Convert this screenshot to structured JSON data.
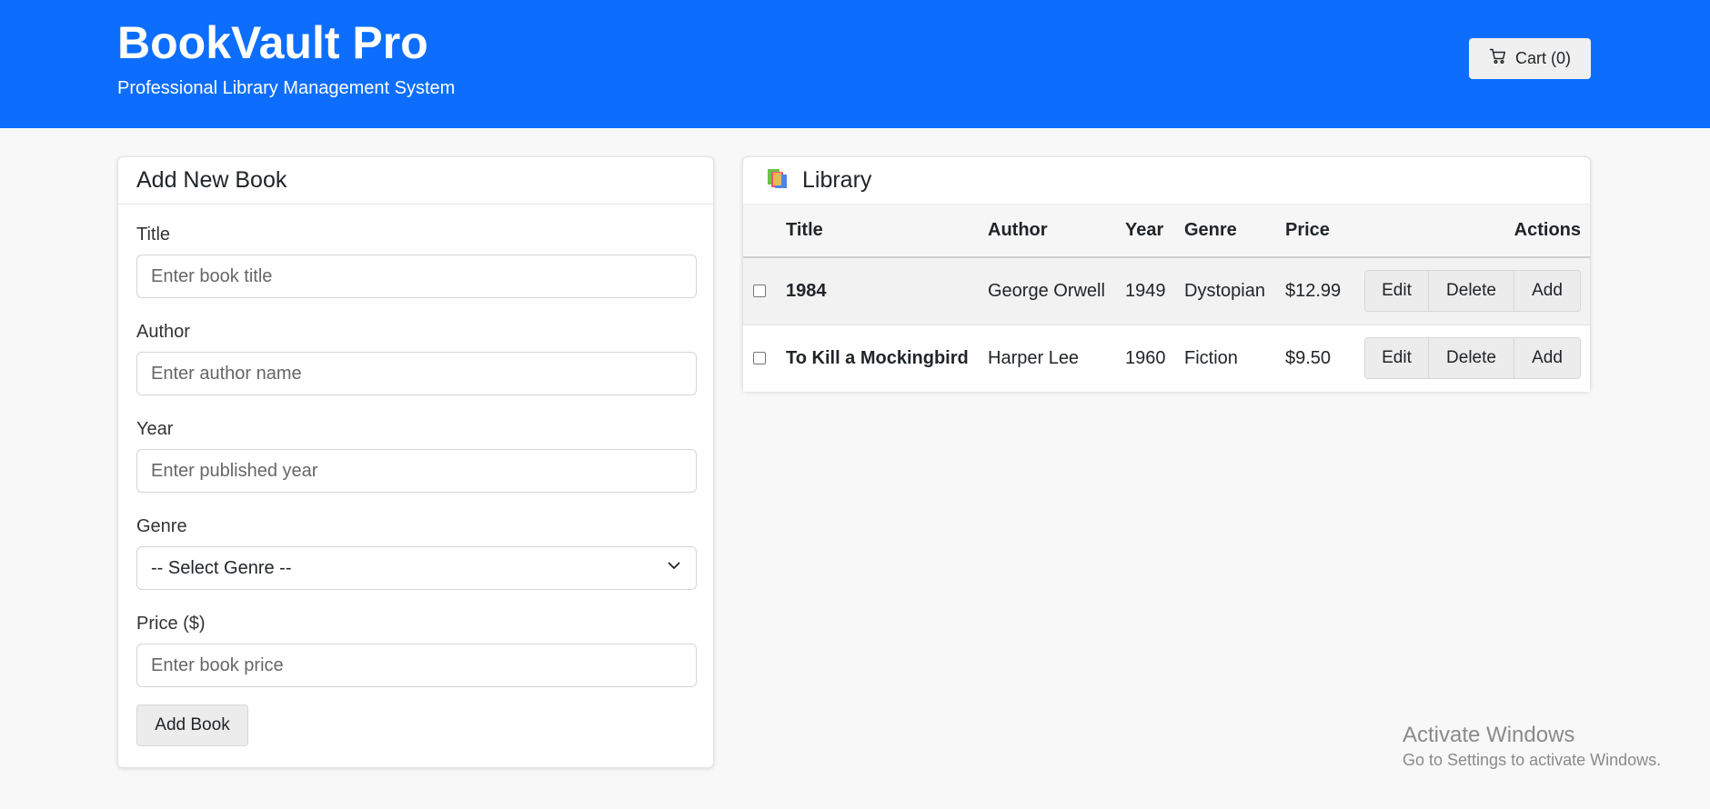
{
  "header": {
    "title": "BookVault Pro",
    "subtitle": "Professional Library Management System",
    "cart_label": "Cart (0)",
    "cart_icon": "cart-icon",
    "background_color": "#0d6efd"
  },
  "form": {
    "heading": "Add New Book",
    "fields": {
      "title": {
        "label": "Title",
        "placeholder": "Enter book title",
        "value": ""
      },
      "author": {
        "label": "Author",
        "placeholder": "Enter author name",
        "value": ""
      },
      "year": {
        "label": "Year",
        "placeholder": "Enter published year",
        "value": ""
      },
      "genre": {
        "label": "Genre",
        "selected": "-- Select Genre --"
      },
      "price": {
        "label": "Price ($)",
        "placeholder": "Enter book price",
        "value": ""
      }
    },
    "submit_label": "Add Book"
  },
  "library": {
    "heading": "Library",
    "icon": "books-icon",
    "columns": {
      "title": "Title",
      "author": "Author",
      "year": "Year",
      "genre": "Genre",
      "price": "Price",
      "actions": "Actions"
    },
    "rows": [
      {
        "title": "1984",
        "author": "George Orwell",
        "year": "1949",
        "genre": "Dystopian",
        "price": "$12.99",
        "checked": false
      },
      {
        "title": "To Kill a Mockingbird",
        "author": "Harper Lee",
        "year": "1960",
        "genre": "Fiction",
        "price": "$9.50",
        "checked": false
      }
    ],
    "actions": {
      "edit": "Edit",
      "delete": "Delete",
      "add": "Add"
    }
  },
  "watermark": {
    "title": "Activate Windows",
    "subtitle": "Go to Settings to activate Windows."
  }
}
